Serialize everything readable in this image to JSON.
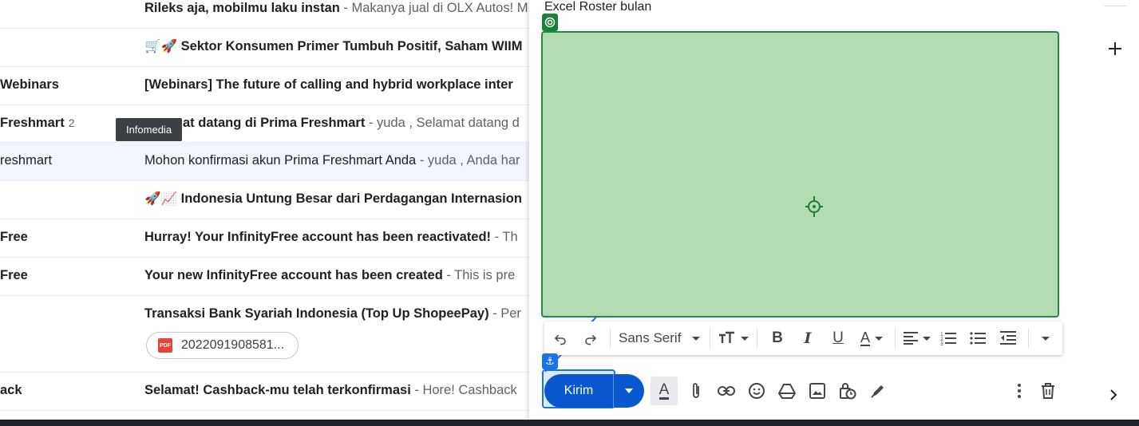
{
  "tooltip": "Infomedia",
  "emails": [
    {
      "sender": "",
      "subject": "Rileks aja, mobilmu laku instan",
      "snippet": " - Makanya jual di OLX Autos! M",
      "bold": true
    },
    {
      "sender": "",
      "subject": "🛒🚀 Sektor Konsumen Primer Tumbuh Positif, Saham WIIM",
      "snippet": "",
      "bold": true
    },
    {
      "sender": "Webinars",
      "subject": "[Webinars] The future of calling and hybrid workplace inter",
      "snippet": "",
      "bold": true
    },
    {
      "sender": "Freshmart",
      "count": "2",
      "subject": "at datang di Prima Freshmart",
      "snippet": " - yuda , Selamat datang d",
      "bold": true
    },
    {
      "sender": "reshmart",
      "subject": "Mohon konfirmasi akun Prima Freshmart Anda",
      "snippet": " - yuda , Anda har",
      "bold": false
    },
    {
      "sender": "",
      "subject": "🚀📈 Indonesia Untung Besar dari Perdagangan Internasion",
      "snippet": "",
      "bold": true
    },
    {
      "sender": "Free",
      "subject": "Hurray! Your InfinityFree account has been reactivated!",
      "snippet": " - Th",
      "bold": true
    },
    {
      "sender": "Free",
      "subject": "Your new InfinityFree account has been created",
      "snippet": " - This is pre",
      "bold": true
    },
    {
      "sender": "",
      "subject": "Transaksi Bank Syariah Indonesia (Top Up ShopeePay)",
      "snippet": " - Per",
      "bold": true,
      "attachment": "2022091908581..."
    },
    {
      "sender": "ack",
      "subject": "Selamat! Cashback-mu telah terkonfirmasi",
      "snippet": " - Hore! Cashback",
      "bold": true
    }
  ],
  "compose": {
    "body_text": "Excel Roster bulan",
    "font_name": "Sans Serif",
    "send_label": "Kirim"
  },
  "colors": {
    "accent": "#0b57d0",
    "image_fill": "#b3dcb4",
    "image_border": "#1e8e3e"
  },
  "icons": [
    "undo-icon",
    "redo-icon",
    "text-size-icon",
    "bold-icon",
    "italic-icon",
    "underline-icon",
    "text-color-icon",
    "align-icon",
    "numbered-list-icon",
    "bulleted-list-icon",
    "indent-less-icon",
    "more-formatting-icon",
    "formatting-options-icon",
    "attach-icon",
    "link-icon",
    "emoji-icon",
    "drive-icon",
    "photo-icon",
    "confidential-icon",
    "signature-icon",
    "more-options-icon",
    "trash-icon",
    "plus-icon",
    "chevron-right-icon"
  ]
}
